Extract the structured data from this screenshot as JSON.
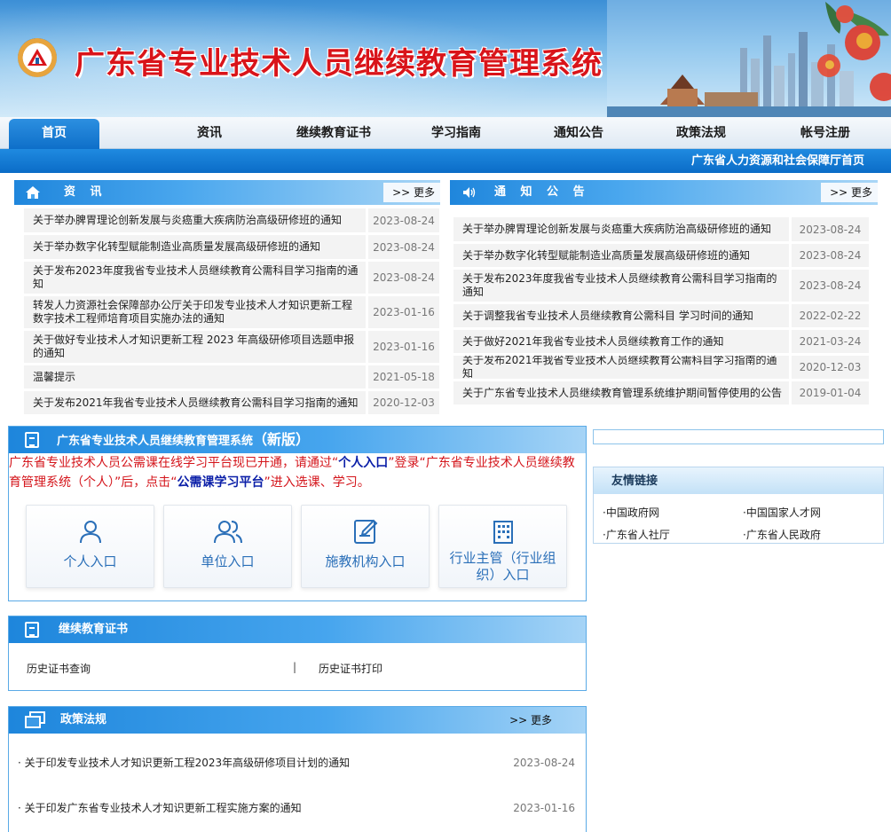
{
  "site": {
    "title": "广东省专业技术人员继续教育管理系统"
  },
  "nav": {
    "items": [
      "首页",
      "资讯",
      "继续教育证书",
      "学习指南",
      "通知公告",
      "政策法规",
      "帐号注册"
    ],
    "subbar_link": "广东省人力资源和社会保障厅首页"
  },
  "news": {
    "title": "资 讯",
    "more": ">> 更多",
    "rows": [
      {
        "text": "关于举办脾胃理论创新发展与炎癌重大疾病防治高级研修班的通知",
        "date": "2023-08-24"
      },
      {
        "text": "关于举办数字化转型赋能制造业高质量发展高级研修班的通知",
        "date": "2023-08-24"
      },
      {
        "text": "关于发布2023年度我省专业技术人员继续教育公需科目学习指南的通知",
        "date": "2023-08-24"
      },
      {
        "text": "转发人力资源社会保障部办公厅关于印发专业技术人才知识更新工程数字技术工程师培育项目实施办法的通知",
        "date": "2023-01-16"
      },
      {
        "text": "关于做好专业技术人才知识更新工程 2023 年高级研修项目选题申报的通知",
        "date": "2023-01-16"
      },
      {
        "text": "温馨提示",
        "date": "2021-05-18"
      },
      {
        "text": "关于发布2021年我省专业技术人员继续教育公需科目学习指南的通知",
        "date": "2020-12-03"
      }
    ]
  },
  "notices": {
    "title": "通 知 公 告",
    "more": ">> 更多",
    "rows": [
      {
        "text": "关于举办脾胃理论创新发展与炎癌重大疾病防治高级研修班的通知",
        "date": "2023-08-24"
      },
      {
        "text": "关于举办数字化转型赋能制造业高质量发展高级研修班的通知",
        "date": "2023-08-24"
      },
      {
        "text": "关于发布2023年度我省专业技术人员继续教育公需科目学习指南的通知",
        "date": "2023-08-24"
      },
      {
        "text": "关于调整我省专业技术人员继续教育公需科目 学习时间的通知",
        "date": "2022-02-22"
      },
      {
        "text": "关于做好2021年我省专业技术人员继续教育工作的通知",
        "date": "2021-03-24"
      },
      {
        "text": "关于发布2021年我省专业技术人员继续教育公需科目学习指南的通知",
        "date": "2020-12-03"
      },
      {
        "text": "关于广东省专业技术人员继续教育管理系统维护期间暂停使用的公告",
        "date": "2019-01-04"
      }
    ]
  },
  "new_system": {
    "title_main": "广东省专业技术人员继续教育管理系统",
    "title_suffix": "（新版）",
    "notice_p1": "广东省专业技术人员公需课在线学习平台现已开通，请通过“",
    "notice_b1": "个人入口",
    "notice_p2": "”登录“广东省专业技术人员继续教育管理系统（个人）”后，点击“",
    "notice_b2": "公需课学习平台",
    "notice_p3": "”进入选课、学习。",
    "entries": [
      "个人入口",
      "单位入口",
      "施教机构入口",
      "行业主管（行业组织）入口"
    ]
  },
  "certificate": {
    "title": "继续教育证书",
    "query": "历史证书查询",
    "separator": "|",
    "print": "历史证书打印"
  },
  "policy": {
    "title": "政策法规",
    "more": ">> 更多",
    "rows": [
      {
        "text": "· 关于印发专业技术人才知识更新工程2023年高级研修项目计划的通知",
        "date": "2023-08-24"
      },
      {
        "text": "· 关于印发广东省专业技术人才知识更新工程实施方案的通知",
        "date": "2023-01-16"
      }
    ]
  },
  "links": {
    "title": "友情链接",
    "items": [
      "·中国政府网",
      "·中国国家人才网",
      "·广东省人社厅",
      "·广东省人民政府"
    ]
  }
}
